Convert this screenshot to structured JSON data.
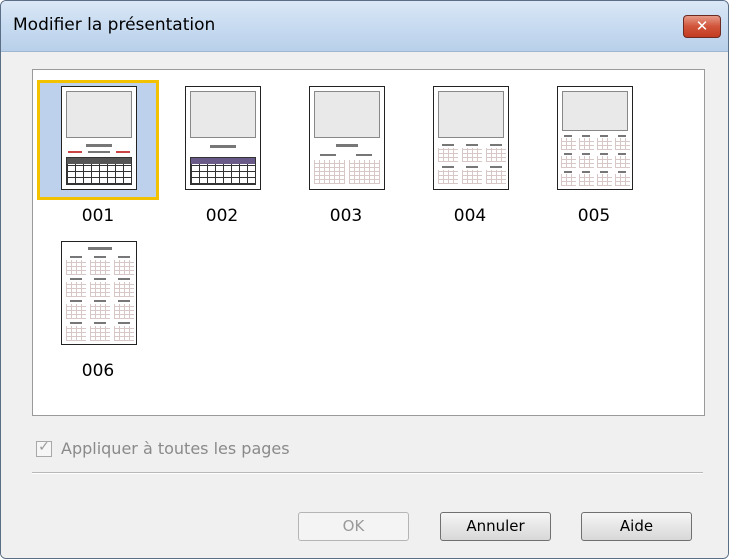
{
  "window": {
    "title": "Modifier la présentation",
    "close_symbol": "✕"
  },
  "layouts": [
    {
      "label": "001",
      "selected": true
    },
    {
      "label": "002",
      "selected": false
    },
    {
      "label": "003",
      "selected": false
    },
    {
      "label": "004",
      "selected": false
    },
    {
      "label": "005",
      "selected": false
    },
    {
      "label": "006",
      "selected": false
    }
  ],
  "apply_all": {
    "label": "Appliquer à toutes les pages",
    "checked": true,
    "check_mark": "✓"
  },
  "buttons": {
    "ok": "OK",
    "cancel": "Annuler",
    "help": "Aide"
  },
  "colors": {
    "selection_outline": "#f2c100",
    "selection_fill": "#bdd1ec"
  }
}
